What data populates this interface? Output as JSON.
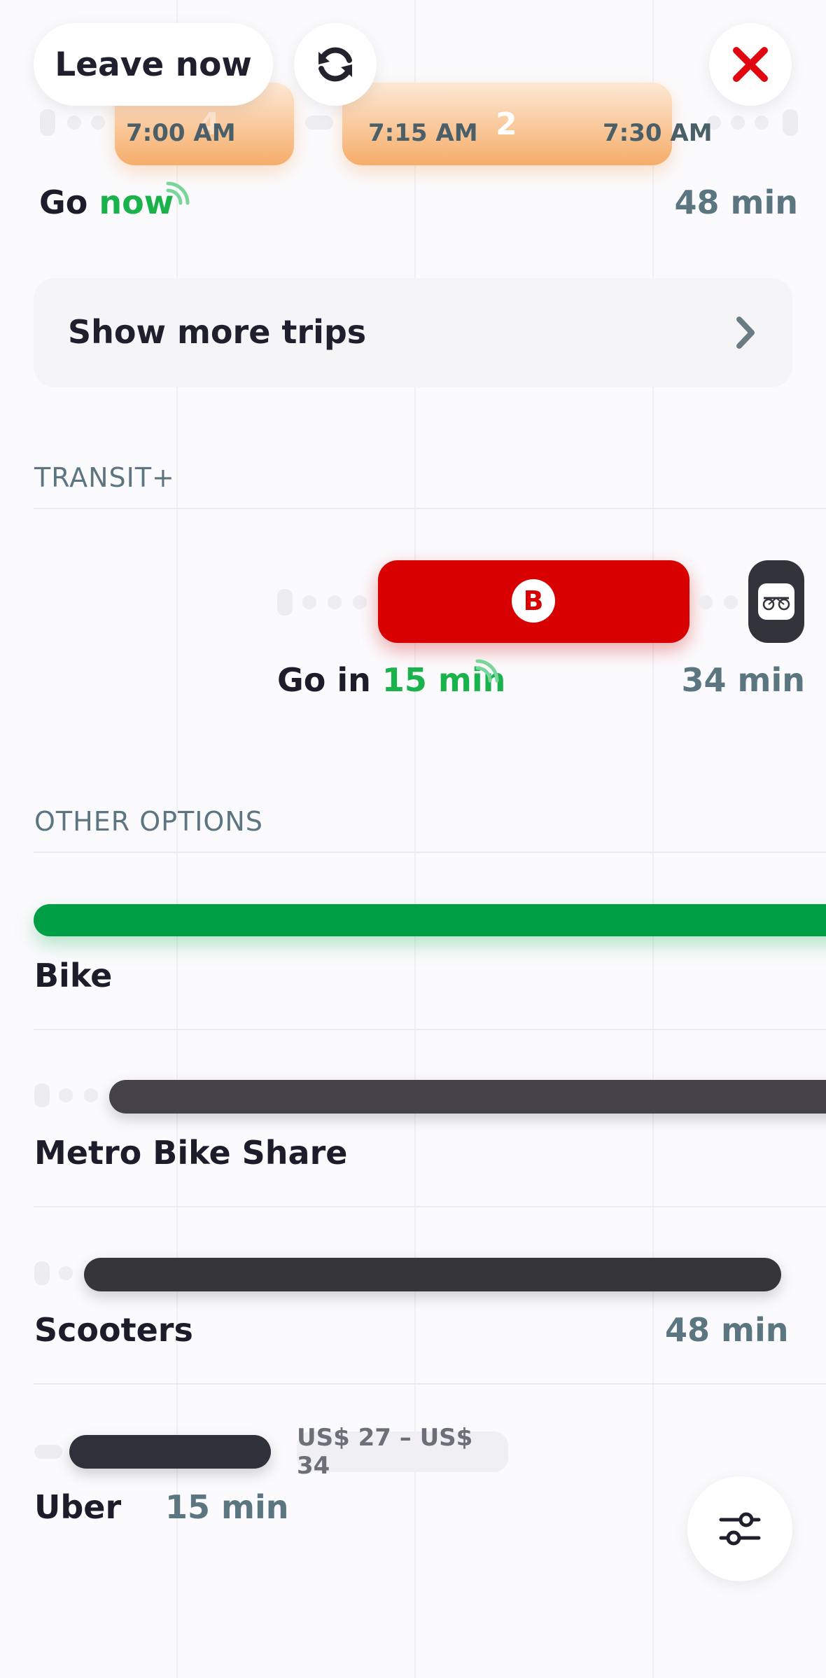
{
  "header": {
    "leave_now": "Leave now"
  },
  "trips": [
    {
      "number": "4",
      "time": "7:00 AM"
    },
    {
      "number": "2",
      "time": "7:15 AM",
      "end_time": "7:30 AM"
    }
  ],
  "top_trip": {
    "go_prefix": "Go",
    "go_highlight": "now",
    "duration": "48 min"
  },
  "show_more": {
    "label": "Show more trips"
  },
  "sections": {
    "transit_plus": "TRANSIT+",
    "other_options": "OTHER OPTIONS"
  },
  "transit_plus": {
    "route_badge": "B",
    "go_prefix": "Go in",
    "go_highlight": "15 min",
    "duration": "34 min"
  },
  "options": [
    {
      "name": "Bike"
    },
    {
      "name": "Metro Bike Share"
    },
    {
      "name": "Scooters",
      "duration": "48 min"
    },
    {
      "name": "Uber",
      "duration": "15 min",
      "price": "US$ 27 – US$ 34"
    }
  ],
  "colors": {
    "accent_green": "#1ab24b",
    "transit_red": "#d80000",
    "close_red": "#e0060f",
    "trip_orange": "#f6ad6a",
    "duration_gray": "#5b7680"
  },
  "icons": [
    "refresh-icon",
    "close-icon",
    "chevron-right-icon",
    "realtime-icon",
    "bike-share-icon",
    "sliders-icon"
  ]
}
